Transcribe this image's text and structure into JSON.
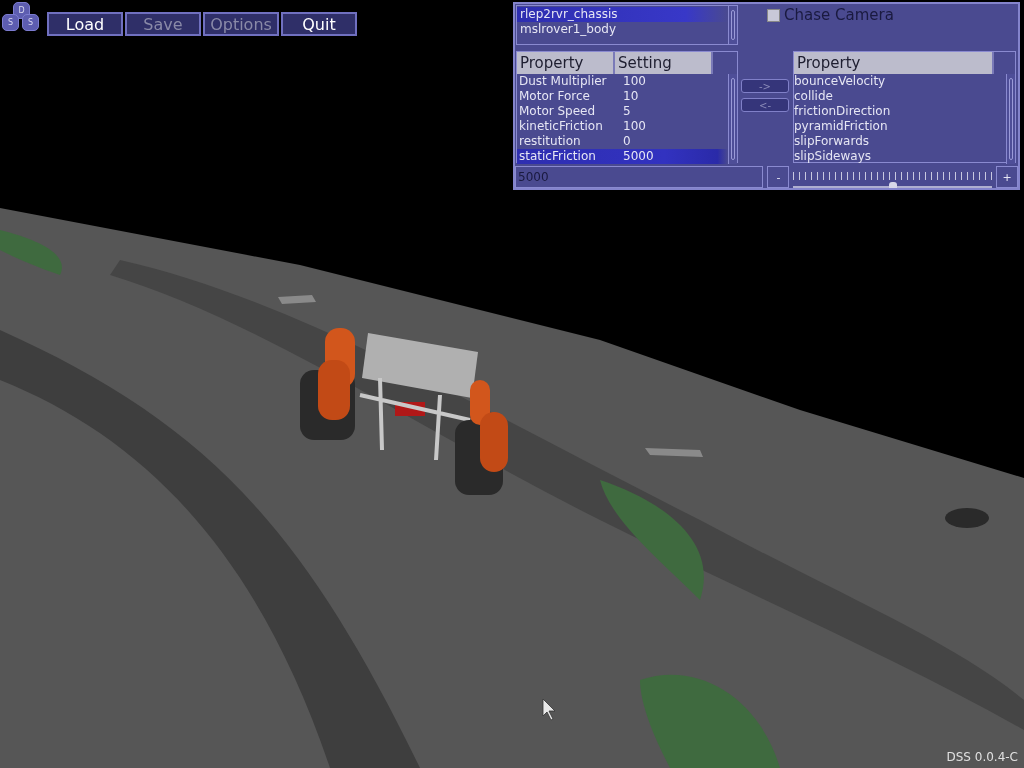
{
  "toolbar": {
    "logo_letters": [
      "D",
      "S",
      "S"
    ],
    "buttons": [
      {
        "label": "Load",
        "disabled": false
      },
      {
        "label": "Save",
        "disabled": true
      },
      {
        "label": "Options",
        "disabled": true
      },
      {
        "label": "Quit",
        "disabled": false
      }
    ]
  },
  "object_list": {
    "items": [
      {
        "name": "rlep2rvr_chassis",
        "selected": true
      },
      {
        "name": "mslrover1_body",
        "selected": false
      }
    ]
  },
  "chase_camera": {
    "label": "Chase Camera",
    "checked": false
  },
  "properties_table": {
    "columns": [
      "Property",
      "Setting"
    ],
    "rows": [
      {
        "property": "Dust Multiplier",
        "setting": "100",
        "selected": false
      },
      {
        "property": "Motor Force",
        "setting": "10",
        "selected": false
      },
      {
        "property": "Motor Speed",
        "setting": "5",
        "selected": false
      },
      {
        "property": "kineticFriction",
        "setting": "100",
        "selected": false
      },
      {
        "property": "restitution",
        "setting": "0",
        "selected": false
      },
      {
        "property": "staticFriction",
        "setting": "5000",
        "selected": true
      }
    ]
  },
  "move_buttons": [
    "->",
    "<-"
  ],
  "available_properties": {
    "column": "Property",
    "items": [
      "bounceVelocity",
      "collide",
      "frictionDirection",
      "pyramidFriction",
      "slipForwards",
      "slipSideways"
    ]
  },
  "value_field": {
    "value": "5000"
  },
  "slider": {
    "minus": "-",
    "plus": "+",
    "level": 0.5
  },
  "version": "DSS 0.0.4-C"
}
